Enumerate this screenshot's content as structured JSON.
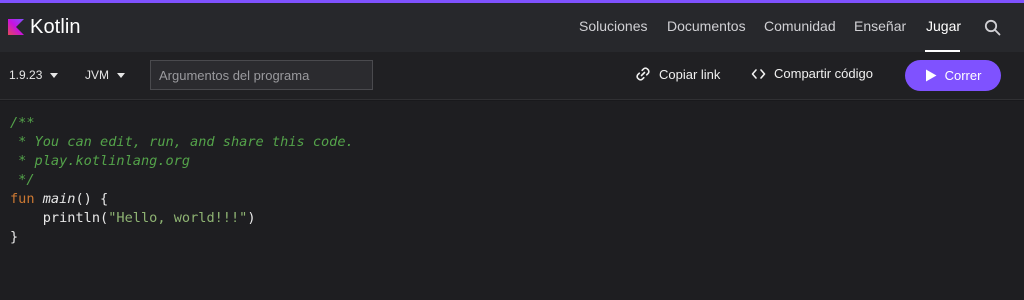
{
  "brand": {
    "name": "Kotlin",
    "accent_color": "#7f52ff",
    "logo_icon": "kotlin-logo-icon"
  },
  "nav": {
    "items": [
      {
        "label": "Soluciones"
      },
      {
        "label": "Documentos"
      },
      {
        "label": "Comunidad"
      },
      {
        "label": "Enseñar"
      },
      {
        "label": "Jugar",
        "active": true
      }
    ],
    "search_icon": "search-icon"
  },
  "toolbar": {
    "version": "1.9.23",
    "target": "JVM",
    "args_placeholder": "Argumentos del programa",
    "args_value": "",
    "copy_link_label": "Copiar link",
    "share_label": "Compartir código",
    "run_label": "Correr"
  },
  "editor": {
    "lines": [
      "/**",
      " * You can edit, run, and share this code.",
      " * play.kotlinlang.org",
      " */",
      "fun main() {",
      "    println(\"Hello, world!!!\")",
      "}"
    ],
    "keyword": "fun",
    "function_name": "main",
    "call": "println",
    "string_literal": "\"Hello, world!!!\"",
    "colors": {
      "comment": "#54a34a",
      "keyword": "#cc7832",
      "string": "#8fb473"
    }
  }
}
